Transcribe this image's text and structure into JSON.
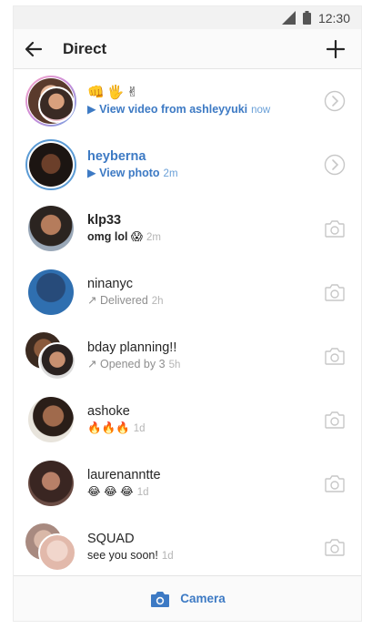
{
  "status_bar": {
    "time": "12:30"
  },
  "header": {
    "title": "Direct"
  },
  "threads": [
    {
      "name": "",
      "emojis": "👊🖐✌",
      "message": "View video from ashleyyuki",
      "time": "now",
      "type": "video",
      "style": "unread"
    },
    {
      "name": "heyberna",
      "message": "View photo",
      "time": "2m",
      "type": "photo",
      "style": "unread"
    },
    {
      "name": "klp33",
      "message": "omg lol 😱",
      "time": "2m",
      "type": "text",
      "style": "bold"
    },
    {
      "name": "ninanyc",
      "message": "Delivered",
      "time": "2h",
      "type": "sent",
      "style": "normal"
    },
    {
      "name": "bday planning!!",
      "message": "Opened by 3",
      "time": "5h",
      "type": "sent",
      "style": "normal"
    },
    {
      "name": "ashoke",
      "message": "🔥🔥🔥",
      "time": "1d",
      "type": "text",
      "style": "normal"
    },
    {
      "name": "laurenanntte",
      "message": "😂 😂 😂",
      "time": "1d",
      "type": "text",
      "style": "normal"
    },
    {
      "name": "SQUAD",
      "message": "see you soon!",
      "time": "1d",
      "type": "text",
      "style": "normal"
    }
  ],
  "footer": {
    "camera_label": "Camera"
  },
  "colors": {
    "accent": "#3d7ac4",
    "ring": "#5b9bd5"
  }
}
